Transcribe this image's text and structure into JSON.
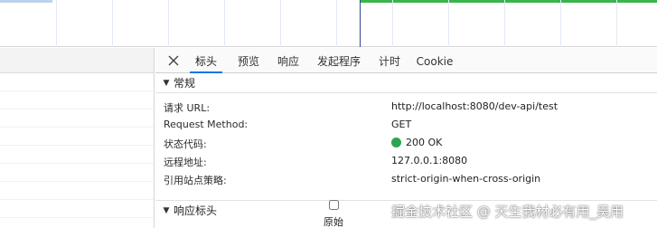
{
  "tabs": [
    {
      "label": "标头",
      "active": true
    },
    {
      "label": "预览",
      "active": false
    },
    {
      "label": "响应",
      "active": false
    },
    {
      "label": "发起程序",
      "active": false
    },
    {
      "label": "计时",
      "active": false
    },
    {
      "label": "Cookie",
      "active": false
    }
  ],
  "general": {
    "title": "常规",
    "expanded": true,
    "rows": [
      {
        "key": "请求 URL:",
        "value": "http://localhost:8080/dev-api/test"
      },
      {
        "key": "Request Method:",
        "value": "GET"
      },
      {
        "key": "状态代码:",
        "value": "200 OK",
        "status_color": "#2ea44f"
      },
      {
        "key": "远程地址:",
        "value": "127.0.0.1:8080"
      },
      {
        "key": "引用站点策略:",
        "value": "strict-origin-when-cross-origin"
      }
    ]
  },
  "response_headers": {
    "title": "响应标头",
    "expanded": true
  },
  "raw_toggle": {
    "label": "原始",
    "checked": false
  },
  "watermark": "掘金技术社区 @ 天生我材必有用_吴用",
  "colors": {
    "accent": "#1a73e8",
    "timeline_green": "#39b54a",
    "status_ok": "#2ea44f"
  }
}
